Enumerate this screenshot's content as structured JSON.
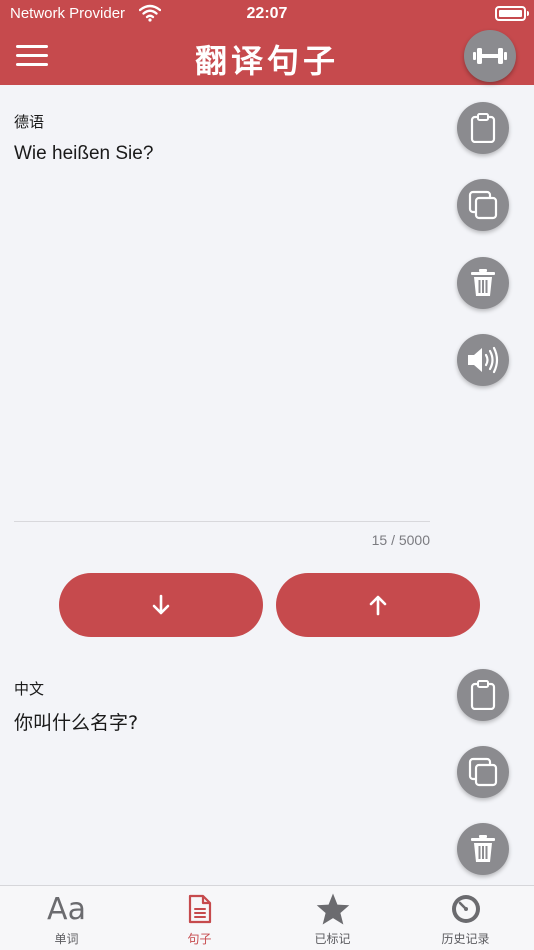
{
  "status_bar": {
    "carrier": "Network Provider",
    "time": "22:07"
  },
  "header": {
    "title": "翻译句子"
  },
  "source": {
    "language": "德语",
    "text": "Wie heißen Sie?",
    "counter": "15 / 5000"
  },
  "target": {
    "language": "中文",
    "text": "你叫什么名字?"
  },
  "tabs": [
    {
      "label": "单词",
      "icon": "letters-aa-icon"
    },
    {
      "label": "句子",
      "icon": "document-icon"
    },
    {
      "label": "已标记",
      "icon": "star-icon"
    },
    {
      "label": "历史记录",
      "icon": "clock-history-icon"
    }
  ],
  "colors": {
    "accent": "#c64a4d",
    "fab": "#8b8b8f",
    "background": "#f3f4f8"
  }
}
